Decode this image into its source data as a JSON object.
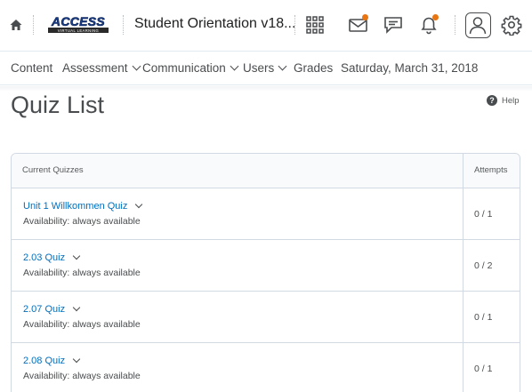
{
  "header": {
    "logo_text": "ACCESS",
    "logo_subtext": "VIRTUAL LEARNING",
    "course_title": "Student Orientation v18...",
    "icons": [
      "home-icon",
      "grid-icon",
      "mail-icon",
      "chat-icon",
      "bell-icon",
      "profile-icon",
      "gear-icon"
    ]
  },
  "nav": {
    "content": "Content",
    "assessment": "Assessment",
    "communication": "Communication",
    "users": "Users",
    "grades": "Grades",
    "date": "Saturday, March 31, 2018"
  },
  "page": {
    "title": "Quiz List",
    "help": "Help"
  },
  "table": {
    "col_quizzes": "Current Quizzes",
    "col_attempts": "Attempts",
    "rows": [
      {
        "name": "Unit 1 Willkommen Quiz",
        "availability": "Availability: always available",
        "attempts": "0 / 1"
      },
      {
        "name": "2.03 Quiz",
        "availability": "Availability: always available",
        "attempts": "0 / 2"
      },
      {
        "name": "2.07 Quiz",
        "availability": "Availability: always available",
        "attempts": "0 / 1"
      },
      {
        "name": "2.08 Quiz",
        "availability": "Availability: always available",
        "attempts": "0 / 1"
      }
    ]
  },
  "colors": {
    "link": "#006fbf",
    "notification": "#e87511",
    "text": "#494c4e"
  }
}
